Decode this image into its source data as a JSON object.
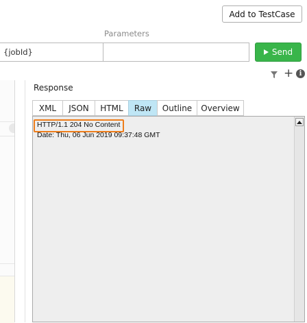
{
  "toolbar": {
    "add_to_testcase_label": "Add to TestCase"
  },
  "request": {
    "parameters_header": "Parameters",
    "url_value": "{jobId}",
    "param_value": "",
    "send_label": "Send"
  },
  "icons": {
    "filter": "filter-icon",
    "add": "plus-icon",
    "info": "info-icon"
  },
  "response": {
    "label": "Response",
    "tabs": [
      {
        "label": "XML"
      },
      {
        "label": "JSON"
      },
      {
        "label": "HTML"
      },
      {
        "label": "Raw",
        "active": true
      },
      {
        "label": "Outline"
      },
      {
        "label": "Overview"
      }
    ],
    "lines": [
      "HTTP/1.1 204 No Content",
      "Date: Thu, 06 Jun 2019 09:37:48 GMT"
    ]
  },
  "colors": {
    "send_button": "#39b54a",
    "active_tab": "#bfe6f5",
    "highlight": "#ee7d1a"
  }
}
